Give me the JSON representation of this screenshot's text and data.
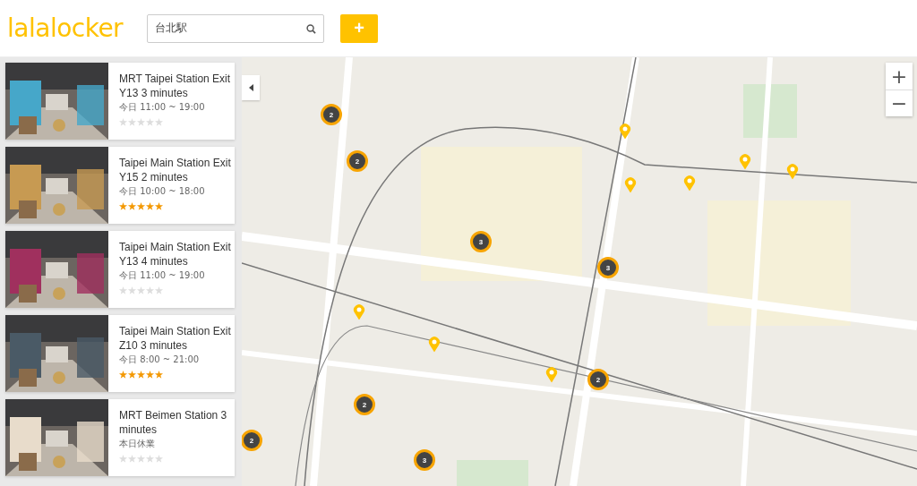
{
  "header": {
    "logo": "lalalocker",
    "search": {
      "value": "台北駅"
    },
    "add_button": "+"
  },
  "lockers": [
    {
      "title": "MRT Taipei Station Exit Y13 3 minutes",
      "hours": "今日 11:00 ~ 19:00",
      "stars": 0
    },
    {
      "title": "Taipei Main Station Exit Y15 2 minutes",
      "hours": "今日 10:00 ~ 18:00",
      "stars": 5
    },
    {
      "title": "Taipei Main Station Exit Y13 4 minutes",
      "hours": "今日 11:00 ~ 19:00",
      "stars": 0
    },
    {
      "title": "Taipei Main Station Exit Z10 3 minutes",
      "hours": "今日 8:00 ~ 21:00",
      "stars": 5
    },
    {
      "title": "MRT Beimen Station 3 minutes",
      "hours": "本日休業",
      "stars": 0
    }
  ],
  "map": {
    "zoom": {
      "in": "+",
      "out": "−"
    },
    "markers": [
      {
        "kind": "cluster",
        "count": "2"
      },
      {
        "kind": "cluster",
        "count": "2"
      },
      {
        "kind": "cluster",
        "count": "3"
      },
      {
        "kind": "cluster",
        "count": "3"
      },
      {
        "kind": "cluster",
        "count": "2"
      },
      {
        "kind": "cluster",
        "count": "2"
      },
      {
        "kind": "cluster",
        "count": "2"
      },
      {
        "kind": "cluster",
        "count": "3"
      },
      {
        "kind": "pin"
      },
      {
        "kind": "pin"
      },
      {
        "kind": "pin"
      },
      {
        "kind": "pin"
      },
      {
        "kind": "pin"
      },
      {
        "kind": "pin"
      },
      {
        "kind": "pin"
      },
      {
        "kind": "pin"
      }
    ]
  }
}
